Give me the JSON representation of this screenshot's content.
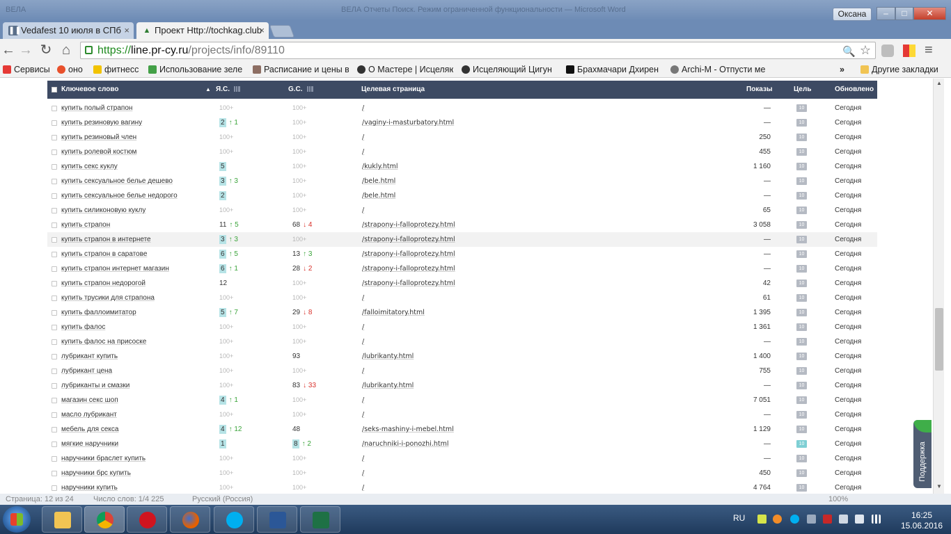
{
  "window": {
    "user_button": "Оксана",
    "ghost_title_left": "ВЕЛА",
    "ghost_title_center": "ВЕЛА Отчеты Поиск. Режим ограниченной функциональности — Microsoft Word",
    "minimize_glyph": "–",
    "maximize_glyph": "□",
    "close_glyph": "✕"
  },
  "tabs": [
    {
      "label": "Vedafest 10 июля в СПб",
      "close": "×"
    },
    {
      "label": "Проект Http://tochkag.club",
      "close": "×"
    }
  ],
  "omnibox": {
    "scheme": "https://",
    "host": "line.pr-cy.ru",
    "path": "/projects/info/89110"
  },
  "icons": {
    "back": "←",
    "forward": "→",
    "reload": "↻",
    "home": "⌂",
    "zoom": "🔍",
    "star": "☆",
    "menu": "≡",
    "more_bookmarks": "»"
  },
  "bookmarks": [
    {
      "label": "Сервисы",
      "color": "#e53935"
    },
    {
      "label": "оно",
      "color": "#e8502b"
    },
    {
      "label": "фитнесс",
      "color": "#f2c300"
    },
    {
      "label": "Использование зеле",
      "color": "#43a047"
    },
    {
      "label": "Расписание и цены в",
      "color": "#8d6e63"
    },
    {
      "label": "О Мастере | Исцеляю",
      "color": "#333333"
    },
    {
      "label": "Исцеляющий Цигун",
      "color": "#333333"
    },
    {
      "label": "Брахмачари Дхирен",
      "color": "#111111"
    },
    {
      "label": "Archi-M - Отпусти ме",
      "color": "#777777"
    }
  ],
  "other_bookmarks": "Другие закладки",
  "table": {
    "headers": {
      "keyword": "Ключевое слово",
      "sort_arrow": "▲",
      "yandex": "Я.С.",
      "google": "G.С.",
      "target": "Целевая страница",
      "views": "Показы",
      "goal": "Цель",
      "updated": "Обновлено"
    },
    "rows": [
      {
        "kw": "купить полый страпон",
        "ya": "100+",
        "ya_style": "muted",
        "ya_chg": "",
        "ya_dir": "",
        "gc": "100+",
        "gc_style": "muted",
        "gc_chg": "",
        "gc_dir": "",
        "page": "/",
        "views": "—",
        "goal": "10",
        "goal_reached": false,
        "upd": "Сегодня"
      },
      {
        "kw": "купить резиновую вагину",
        "ya": "2",
        "ya_style": "badge",
        "ya_chg": "↑ 1",
        "ya_dir": "up",
        "gc": "100+",
        "gc_style": "muted",
        "gc_chg": "",
        "gc_dir": "",
        "page": "/vaginy-i-masturbatory.html",
        "views": "—",
        "goal": "10",
        "goal_reached": false,
        "upd": "Сегодня"
      },
      {
        "kw": "купить резиновый член",
        "ya": "100+",
        "ya_style": "muted",
        "ya_chg": "",
        "ya_dir": "",
        "gc": "100+",
        "gc_style": "muted",
        "gc_chg": "",
        "gc_dir": "",
        "page": "/",
        "views": "250",
        "goal": "10",
        "goal_reached": false,
        "upd": "Сегодня"
      },
      {
        "kw": "купить ролевой костюм",
        "ya": "100+",
        "ya_style": "muted",
        "ya_chg": "",
        "ya_dir": "",
        "gc": "100+",
        "gc_style": "muted",
        "gc_chg": "",
        "gc_dir": "",
        "page": "/",
        "views": "455",
        "goal": "10",
        "goal_reached": false,
        "upd": "Сегодня"
      },
      {
        "kw": "купить секс куклу",
        "ya": "5",
        "ya_style": "badge",
        "ya_chg": "",
        "ya_dir": "",
        "gc": "100+",
        "gc_style": "muted",
        "gc_chg": "",
        "gc_dir": "",
        "page": "/kukly.html",
        "views": "1 160",
        "goal": "10",
        "goal_reached": false,
        "upd": "Сегодня"
      },
      {
        "kw": "купить сексуальное белье дешево",
        "ya": "3",
        "ya_style": "badge",
        "ya_chg": "↑ 3",
        "ya_dir": "up",
        "gc": "100+",
        "gc_style": "muted",
        "gc_chg": "",
        "gc_dir": "",
        "page": "/bele.html",
        "views": "—",
        "goal": "10",
        "goal_reached": false,
        "upd": "Сегодня"
      },
      {
        "kw": "купить сексуальное белье недорого",
        "ya": "2",
        "ya_style": "badge",
        "ya_chg": "",
        "ya_dir": "",
        "gc": "100+",
        "gc_style": "muted",
        "gc_chg": "",
        "gc_dir": "",
        "page": "/bele.html",
        "views": "—",
        "goal": "10",
        "goal_reached": false,
        "upd": "Сегодня"
      },
      {
        "kw": "купить силиконовую куклу",
        "ya": "100+",
        "ya_style": "muted",
        "ya_chg": "",
        "ya_dir": "",
        "gc": "100+",
        "gc_style": "muted",
        "gc_chg": "",
        "gc_dir": "",
        "page": "/",
        "views": "65",
        "goal": "10",
        "goal_reached": false,
        "upd": "Сегодня"
      },
      {
        "kw": "купить страпон",
        "ya": "11",
        "ya_style": "plain",
        "ya_chg": "↑ 5",
        "ya_dir": "up",
        "gc": "68",
        "gc_style": "plain",
        "gc_chg": "↓ 4",
        "gc_dir": "down",
        "page": "/strapony-i-falloprotezy.html",
        "views": "3 058",
        "goal": "10",
        "goal_reached": false,
        "upd": "Сегодня"
      },
      {
        "kw": "купить страпон в интернете",
        "ya": "3",
        "ya_style": "badge",
        "ya_chg": "↑ 3",
        "ya_dir": "up",
        "gc": "100+",
        "gc_style": "muted",
        "gc_chg": "",
        "gc_dir": "",
        "page": "/strapony-i-falloprotezy.html",
        "views": "—",
        "goal": "10",
        "goal_reached": false,
        "upd": "Сегодня"
      },
      {
        "kw": "купить страпон в саратове",
        "ya": "6",
        "ya_style": "badge",
        "ya_chg": "↑ 5",
        "ya_dir": "up",
        "gc": "13",
        "gc_style": "plain",
        "gc_chg": "↑ 3",
        "gc_dir": "up",
        "page": "/strapony-i-falloprotezy.html",
        "views": "—",
        "goal": "10",
        "goal_reached": false,
        "upd": "Сегодня"
      },
      {
        "kw": "купить страпон интернет магазин",
        "ya": "6",
        "ya_style": "badge",
        "ya_chg": "↑ 1",
        "ya_dir": "up",
        "gc": "28",
        "gc_style": "plain",
        "gc_chg": "↓ 2",
        "gc_dir": "down",
        "page": "/strapony-i-falloprotezy.html",
        "views": "—",
        "goal": "10",
        "goal_reached": false,
        "upd": "Сегодня"
      },
      {
        "kw": "купить страпон недорогой",
        "ya": "12",
        "ya_style": "plain",
        "ya_chg": "",
        "ya_dir": "",
        "gc": "100+",
        "gc_style": "muted",
        "gc_chg": "",
        "gc_dir": "",
        "page": "/strapony-i-falloprotezy.html",
        "views": "42",
        "goal": "10",
        "goal_reached": false,
        "upd": "Сегодня"
      },
      {
        "kw": "купить трусики для страпона",
        "ya": "100+",
        "ya_style": "muted",
        "ya_chg": "",
        "ya_dir": "",
        "gc": "100+",
        "gc_style": "muted",
        "gc_chg": "",
        "gc_dir": "",
        "page": "/",
        "views": "61",
        "goal": "10",
        "goal_reached": false,
        "upd": "Сегодня"
      },
      {
        "kw": "купить фаллоимитатор",
        "ya": "5",
        "ya_style": "badge",
        "ya_chg": "↑ 7",
        "ya_dir": "up",
        "gc": "29",
        "gc_style": "plain",
        "gc_chg": "↓ 8",
        "gc_dir": "down",
        "page": "/falloimitatory.html",
        "views": "1 395",
        "goal": "10",
        "goal_reached": false,
        "upd": "Сегодня"
      },
      {
        "kw": "купить фалос",
        "ya": "100+",
        "ya_style": "muted",
        "ya_chg": "",
        "ya_dir": "",
        "gc": "100+",
        "gc_style": "muted",
        "gc_chg": "",
        "gc_dir": "",
        "page": "/",
        "views": "1 361",
        "goal": "10",
        "goal_reached": false,
        "upd": "Сегодня"
      },
      {
        "kw": "купить фалос на присоске",
        "ya": "100+",
        "ya_style": "muted",
        "ya_chg": "",
        "ya_dir": "",
        "gc": "100+",
        "gc_style": "muted",
        "gc_chg": "",
        "gc_dir": "",
        "page": "/",
        "views": "—",
        "goal": "10",
        "goal_reached": false,
        "upd": "Сегодня"
      },
      {
        "kw": "лубрикант купить",
        "ya": "100+",
        "ya_style": "muted",
        "ya_chg": "",
        "ya_dir": "",
        "gc": "93",
        "gc_style": "plain",
        "gc_chg": "",
        "gc_dir": "",
        "page": "/lubrikanty.html",
        "views": "1 400",
        "goal": "10",
        "goal_reached": false,
        "upd": "Сегодня"
      },
      {
        "kw": "лубрикант цена",
        "ya": "100+",
        "ya_style": "muted",
        "ya_chg": "",
        "ya_dir": "",
        "gc": "100+",
        "gc_style": "muted",
        "gc_chg": "",
        "gc_dir": "",
        "page": "/",
        "views": "755",
        "goal": "10",
        "goal_reached": false,
        "upd": "Сегодня"
      },
      {
        "kw": "лубриканты и смазки",
        "ya": "100+",
        "ya_style": "muted",
        "ya_chg": "",
        "ya_dir": "",
        "gc": "83",
        "gc_style": "plain",
        "gc_chg": "↓ 33",
        "gc_dir": "down",
        "page": "/lubrikanty.html",
        "views": "—",
        "goal": "10",
        "goal_reached": false,
        "upd": "Сегодня"
      },
      {
        "kw": "магазин секс шоп",
        "ya": "4",
        "ya_style": "badge",
        "ya_chg": "↑ 1",
        "ya_dir": "up",
        "gc": "100+",
        "gc_style": "muted",
        "gc_chg": "",
        "gc_dir": "",
        "page": "/",
        "views": "7 051",
        "goal": "10",
        "goal_reached": false,
        "upd": "Сегодня"
      },
      {
        "kw": "масло лубрикант",
        "ya": "100+",
        "ya_style": "muted",
        "ya_chg": "",
        "ya_dir": "",
        "gc": "100+",
        "gc_style": "muted",
        "gc_chg": "",
        "gc_dir": "",
        "page": "/",
        "views": "—",
        "goal": "10",
        "goal_reached": false,
        "upd": "Сегодня"
      },
      {
        "kw": "мебель для секса",
        "ya": "4",
        "ya_style": "badge",
        "ya_chg": "↑ 12",
        "ya_dir": "up",
        "gc": "48",
        "gc_style": "plain",
        "gc_chg": "",
        "gc_dir": "",
        "page": "/seks-mashiny-i-mebel.html",
        "views": "1 129",
        "goal": "10",
        "goal_reached": false,
        "upd": "Сегодня"
      },
      {
        "kw": "мягкие наручники",
        "ya": "1",
        "ya_style": "badge",
        "ya_chg": "",
        "ya_dir": "",
        "gc": "8",
        "gc_style": "badge",
        "gc_chg": "↑ 2",
        "gc_dir": "up",
        "page": "/naruchniki-i-ponozhi.html",
        "views": "—",
        "goal": "10",
        "goal_reached": true,
        "upd": "Сегодня"
      },
      {
        "kw": "наручники браслет купить",
        "ya": "100+",
        "ya_style": "muted",
        "ya_chg": "",
        "ya_dir": "",
        "gc": "100+",
        "gc_style": "muted",
        "gc_chg": "",
        "gc_dir": "",
        "page": "/",
        "views": "—",
        "goal": "10",
        "goal_reached": false,
        "upd": "Сегодня"
      },
      {
        "kw": "наручники брс купить",
        "ya": "100+",
        "ya_style": "muted",
        "ya_chg": "",
        "ya_dir": "",
        "gc": "100+",
        "gc_style": "muted",
        "gc_chg": "",
        "gc_dir": "",
        "page": "/",
        "views": "450",
        "goal": "10",
        "goal_reached": false,
        "upd": "Сегодня"
      },
      {
        "kw": "наручники купить",
        "ya": "100+",
        "ya_style": "muted",
        "ya_chg": "",
        "ya_dir": "",
        "gc": "100+",
        "gc_style": "muted",
        "gc_chg": "",
        "gc_dir": "",
        "page": "/",
        "views": "4 764",
        "goal": "10",
        "goal_reached": false,
        "upd": "Сегодня"
      }
    ]
  },
  "support_tab": "Поддержка",
  "underlay": {
    "page_count": "Страница: 12 из 24",
    "word_count": "Число слов: 1/4 225",
    "language": "Русский (Россия)",
    "zoom": "100%"
  },
  "taskbar": {
    "apps": [
      "explorer",
      "chrome",
      "opera",
      "firefox",
      "skype",
      "word",
      "excel"
    ],
    "language": "RU",
    "time": "16:25",
    "date": "15.06.2016"
  }
}
